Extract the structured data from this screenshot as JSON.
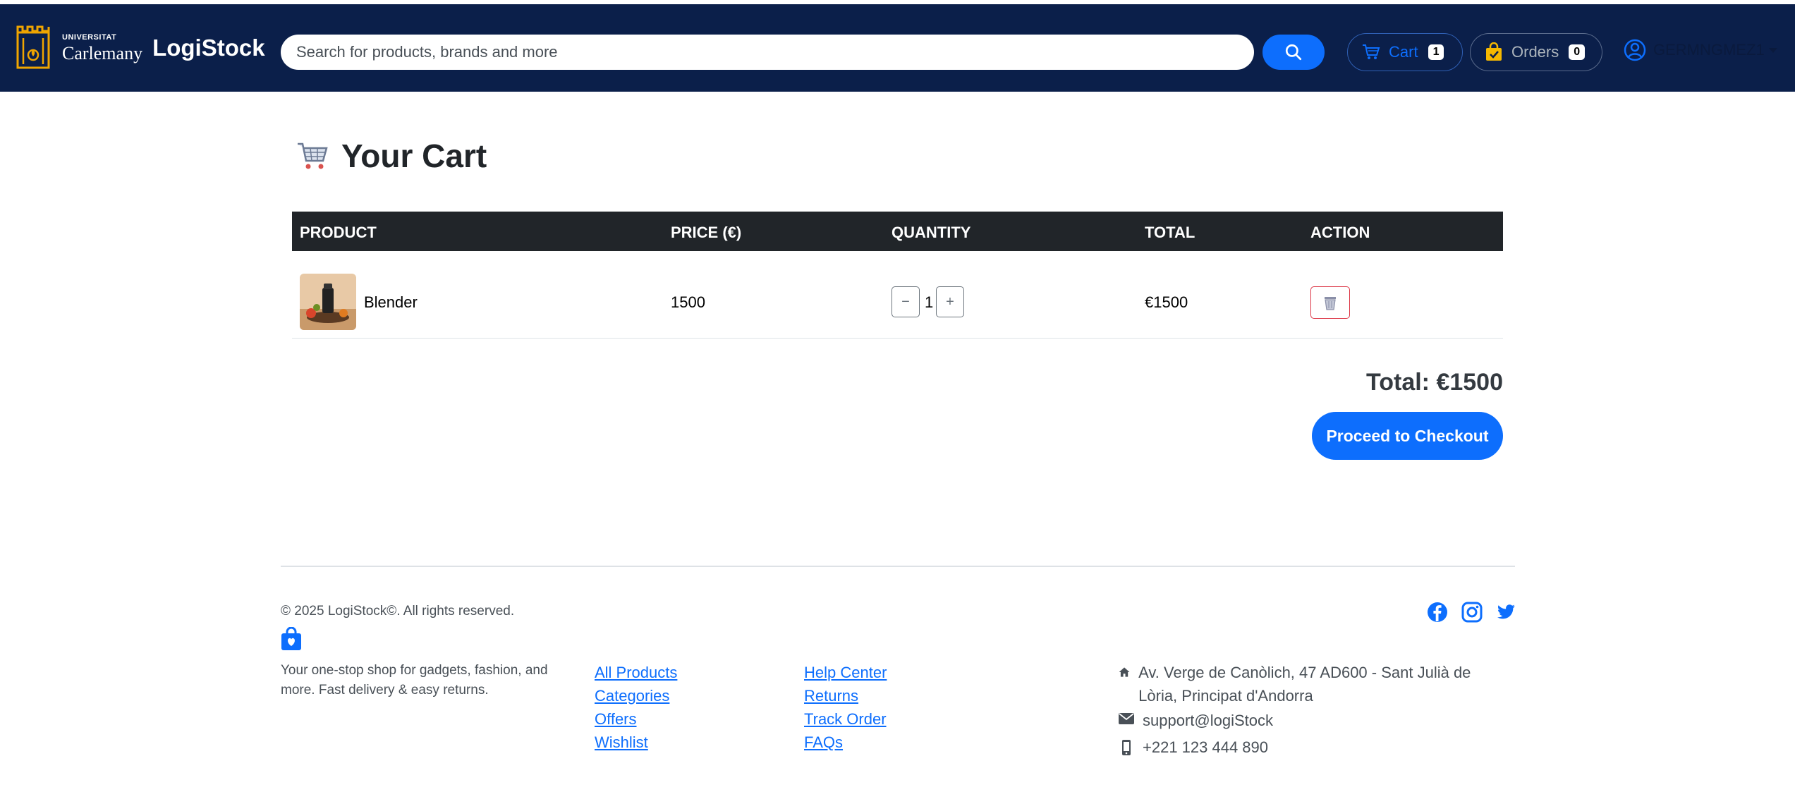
{
  "navbar": {
    "logo_small": "UNIVERSITAT",
    "logo_big": "Carlemany",
    "brand": "LogiStock",
    "search_placeholder": "Search for products, brands and more",
    "cart_label": "Cart",
    "cart_count": "1",
    "orders_label": "Orders",
    "orders_count": "0",
    "username": "GERMNGMEZ1"
  },
  "main": {
    "title": "Your Cart",
    "columns": [
      "PRODUCT",
      "PRICE (€)",
      "QUANTITY",
      "TOTAL",
      "ACTION"
    ],
    "items": [
      {
        "name": "Blender",
        "price": "1500",
        "quantity": "1",
        "total": "€1500",
        "minus": "−",
        "plus": "+"
      }
    ],
    "grand_total": "Total: €1500",
    "checkout_label": "Proceed to Checkout"
  },
  "footer": {
    "copyright": "© 2025 LogiStock©. All rights reserved.",
    "tagline": "Your one-stop shop for gadgets, fashion, and more. Fast delivery & easy returns.",
    "links_col1": [
      "All Products",
      "Categories",
      "Offers",
      "Wishlist"
    ],
    "links_col2": [
      "Help Center",
      "Returns",
      "Track Order",
      "FAQs"
    ],
    "address": "Av. Verge de Canòlich, 47 AD600 - Sant Julià de Lòria, Principat d'Andorra",
    "email": "support@logiStock",
    "phone": "+221 123 444 890"
  },
  "colors": {
    "navbar_bg": "#0b1f4a",
    "primary": "#0d6efd",
    "table_header_bg": "#212529",
    "danger": "#dc3545"
  },
  "icons": [
    "university-crest-icon",
    "search-icon",
    "cart-icon",
    "shopping-bag-icon",
    "user-circle-icon",
    "shopping-cart-emoji-icon",
    "trash-icon",
    "facebook-icon",
    "instagram-icon",
    "twitter-icon",
    "home-icon",
    "envelope-icon",
    "phone-icon"
  ]
}
